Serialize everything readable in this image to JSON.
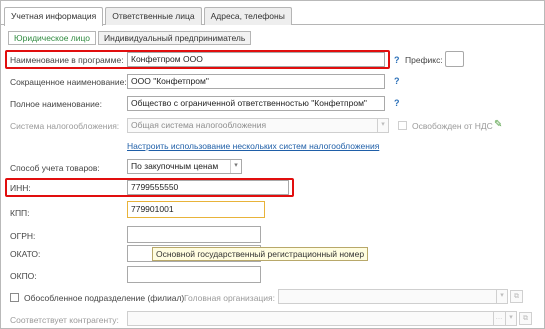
{
  "tabs": [
    {
      "label": "Учетная информация",
      "active": true
    },
    {
      "label": "Ответственные лица",
      "active": false
    },
    {
      "label": "Адреса, телефоны",
      "active": false
    }
  ],
  "subtabs": [
    {
      "label": "Юридическое лицо",
      "active": true
    },
    {
      "label": "Индивидуальный предприниматель",
      "active": false
    }
  ],
  "form": {
    "name_in_program": {
      "label": "Наименование в программе:",
      "value": "Конфетпром ООО"
    },
    "prefix": {
      "label": "Префикс:",
      "value": ""
    },
    "short_name": {
      "label": "Сокращенное наименование:",
      "value": "ООО \"Конфетпром\""
    },
    "full_name": {
      "label": "Полное наименование:",
      "value": "Общество с ограниченной ответственностью \"Конфетпром\""
    },
    "tax_system": {
      "label": "Система налогообложения:",
      "value": "Общая система налогообложения"
    },
    "vat_exempt": {
      "label": "Освобожден от НДС",
      "checked": false
    },
    "multi_tax_link": "Настроить использование нескольких систем налогообложения",
    "goods_accounting": {
      "label": "Способ учета товаров:",
      "value": "По закупочным ценам"
    },
    "inn": {
      "label": "ИНН:",
      "value": "7799555550"
    },
    "kpp": {
      "label": "КПП:",
      "value": "779901001"
    },
    "ogrn": {
      "label": "ОГРН:",
      "value": ""
    },
    "okato": {
      "label": "ОКАТО:",
      "value": ""
    },
    "okpo": {
      "label": "ОКПО:",
      "value": ""
    },
    "branch": {
      "label": "Обособленное подразделение (филиал)",
      "checked": false
    },
    "head_org": {
      "label": "Головная организация:",
      "value": ""
    },
    "counterparty": {
      "label": "Соответствует контрагенту:",
      "value": ""
    }
  },
  "help_marker": "?",
  "tooltip": "Основной государственный регистрационный номер",
  "icons": {
    "dropdown": "▾",
    "ellipsis": "…",
    "open": "⧉",
    "edit": "✎"
  },
  "colors": {
    "highlight": "#e10e0e",
    "link": "#1f5fa8",
    "active_subtab": "#2f8a3f",
    "focus": "#e8b33a"
  }
}
